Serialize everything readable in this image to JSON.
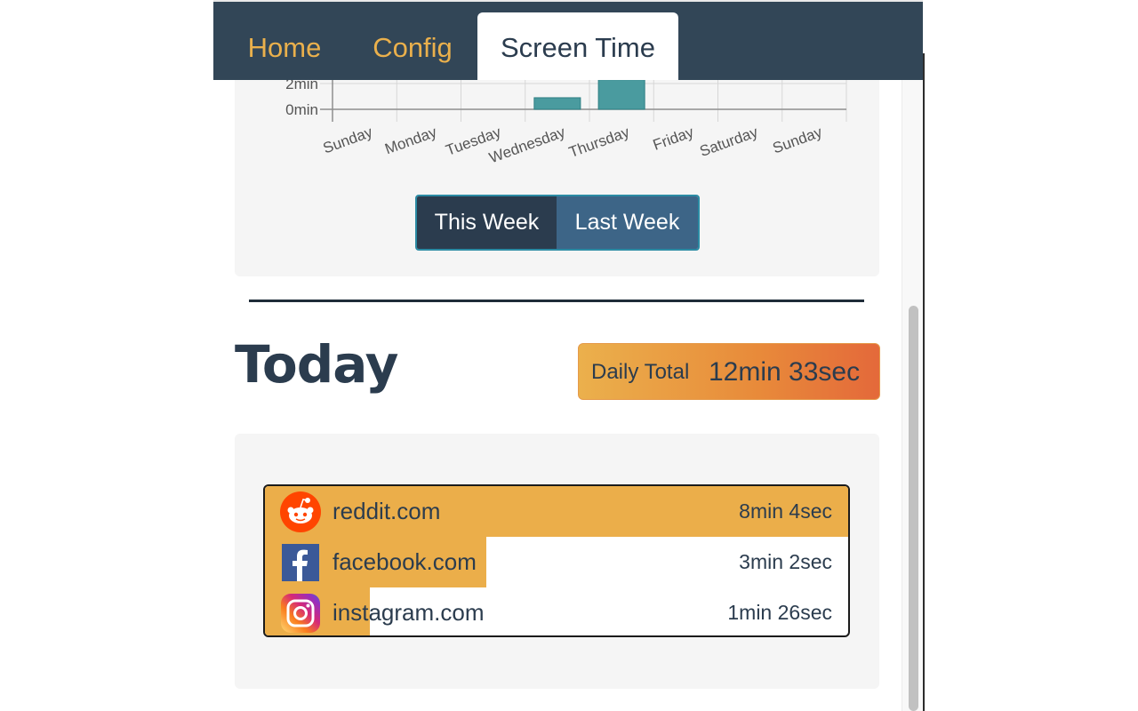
{
  "nav": {
    "tabs": [
      {
        "label": "Home"
      },
      {
        "label": "Config"
      },
      {
        "label": "Screen Time",
        "active": true
      }
    ]
  },
  "chart_data": {
    "type": "bar",
    "categories": [
      "Sunday",
      "Monday",
      "Tuesday",
      "Wednesday",
      "Thursday",
      "Friday",
      "Saturday",
      "Sunday"
    ],
    "values": [
      0,
      0,
      0,
      0.9,
      2.3,
      0,
      0,
      0
    ],
    "visible_y_ticks": [
      "2min",
      "0min"
    ],
    "y_tick_values": [
      2,
      0
    ],
    "ylabel": "",
    "bar_color": "#4a9b9f",
    "grid": true
  },
  "week_toggle": {
    "this_week": "This Week",
    "last_week": "Last Week",
    "selected": "This Week"
  },
  "today": {
    "title": "Today",
    "daily_total_label": "Daily Total",
    "daily_total_value": "12min 33sec"
  },
  "sites": [
    {
      "name": "reddit.com",
      "time": "8min 4sec",
      "icon": "reddit-icon",
      "share": 1.0
    },
    {
      "name": "facebook.com",
      "time": "3min 2sec",
      "icon": "facebook-icon",
      "share": 0.38
    },
    {
      "name": "instagram.com",
      "time": "1min 26sec",
      "icon": "instagram-icon",
      "share": 0.18
    }
  ],
  "colors": {
    "nav_bg": "#324657",
    "tab_inactive": "#eab04c",
    "dark_text": "#2b3c4e",
    "usage_fill": "#ebae4a",
    "badge_gradient_start": "#ebb04c",
    "badge_gradient_end": "#e4693a"
  }
}
